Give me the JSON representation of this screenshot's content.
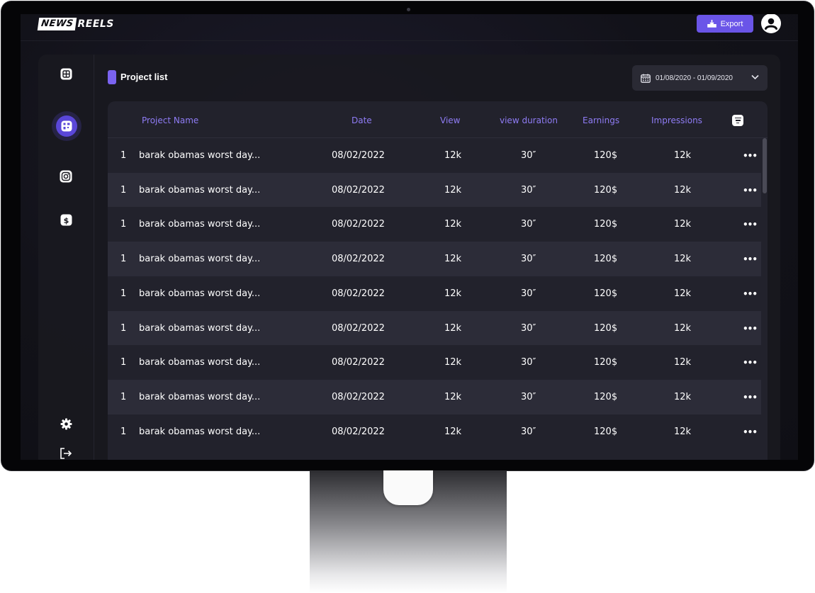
{
  "brand": {
    "part1": "NEWS",
    "part2": "REELS"
  },
  "header": {
    "export_label": "Export"
  },
  "page": {
    "title": "Project list",
    "date_range": "01/08/2020 - 01/09/2020"
  },
  "colors": {
    "accent": "#6a55e8",
    "panel": "#191920",
    "row_alt": "#2c2c38",
    "header_text": "#8f7cf5"
  },
  "sidebar": {
    "items": [
      {
        "icon": "grid-icon",
        "active": false
      },
      {
        "icon": "dashboard-icon",
        "active": true
      },
      {
        "icon": "instagram-icon",
        "active": false
      },
      {
        "icon": "dollar-icon",
        "active": false
      }
    ],
    "bottom": [
      {
        "icon": "gear-icon"
      },
      {
        "icon": "logout-icon"
      }
    ]
  },
  "table": {
    "columns": [
      "Project Name",
      "Date",
      "View",
      "view duration",
      "Earnings",
      "Impressions"
    ],
    "rows": [
      {
        "num": "1",
        "name": "barak obamas worst day...",
        "date": "08/02/2022",
        "view": "12k",
        "duration": "30″",
        "earnings": "120$",
        "impressions": "12k",
        "more": "•••"
      },
      {
        "num": "1",
        "name": "barak obamas worst day...",
        "date": "08/02/2022",
        "view": "12k",
        "duration": "30″",
        "earnings": "120$",
        "impressions": "12k",
        "more": "•••"
      },
      {
        "num": "1",
        "name": "barak obamas worst day...",
        "date": "08/02/2022",
        "view": "12k",
        "duration": "30″",
        "earnings": "120$",
        "impressions": "12k",
        "more": "•••"
      },
      {
        "num": "1",
        "name": "barak obamas worst day...",
        "date": "08/02/2022",
        "view": "12k",
        "duration": "30″",
        "earnings": "120$",
        "impressions": "12k",
        "more": "•••"
      },
      {
        "num": "1",
        "name": "barak obamas worst day...",
        "date": "08/02/2022",
        "view": "12k",
        "duration": "30″",
        "earnings": "120$",
        "impressions": "12k",
        "more": "•••"
      },
      {
        "num": "1",
        "name": "barak obamas worst day...",
        "date": "08/02/2022",
        "view": "12k",
        "duration": "30″",
        "earnings": "120$",
        "impressions": "12k",
        "more": "•••"
      },
      {
        "num": "1",
        "name": "barak obamas worst day...",
        "date": "08/02/2022",
        "view": "12k",
        "duration": "30″",
        "earnings": "120$",
        "impressions": "12k",
        "more": "•••"
      },
      {
        "num": "1",
        "name": "barak obamas worst day...",
        "date": "08/02/2022",
        "view": "12k",
        "duration": "30″",
        "earnings": "120$",
        "impressions": "12k",
        "more": "•••"
      },
      {
        "num": "1",
        "name": "barak obamas worst day...",
        "date": "08/02/2022",
        "view": "12k",
        "duration": "30″",
        "earnings": "120$",
        "impressions": "12k",
        "more": "•••"
      }
    ]
  }
}
